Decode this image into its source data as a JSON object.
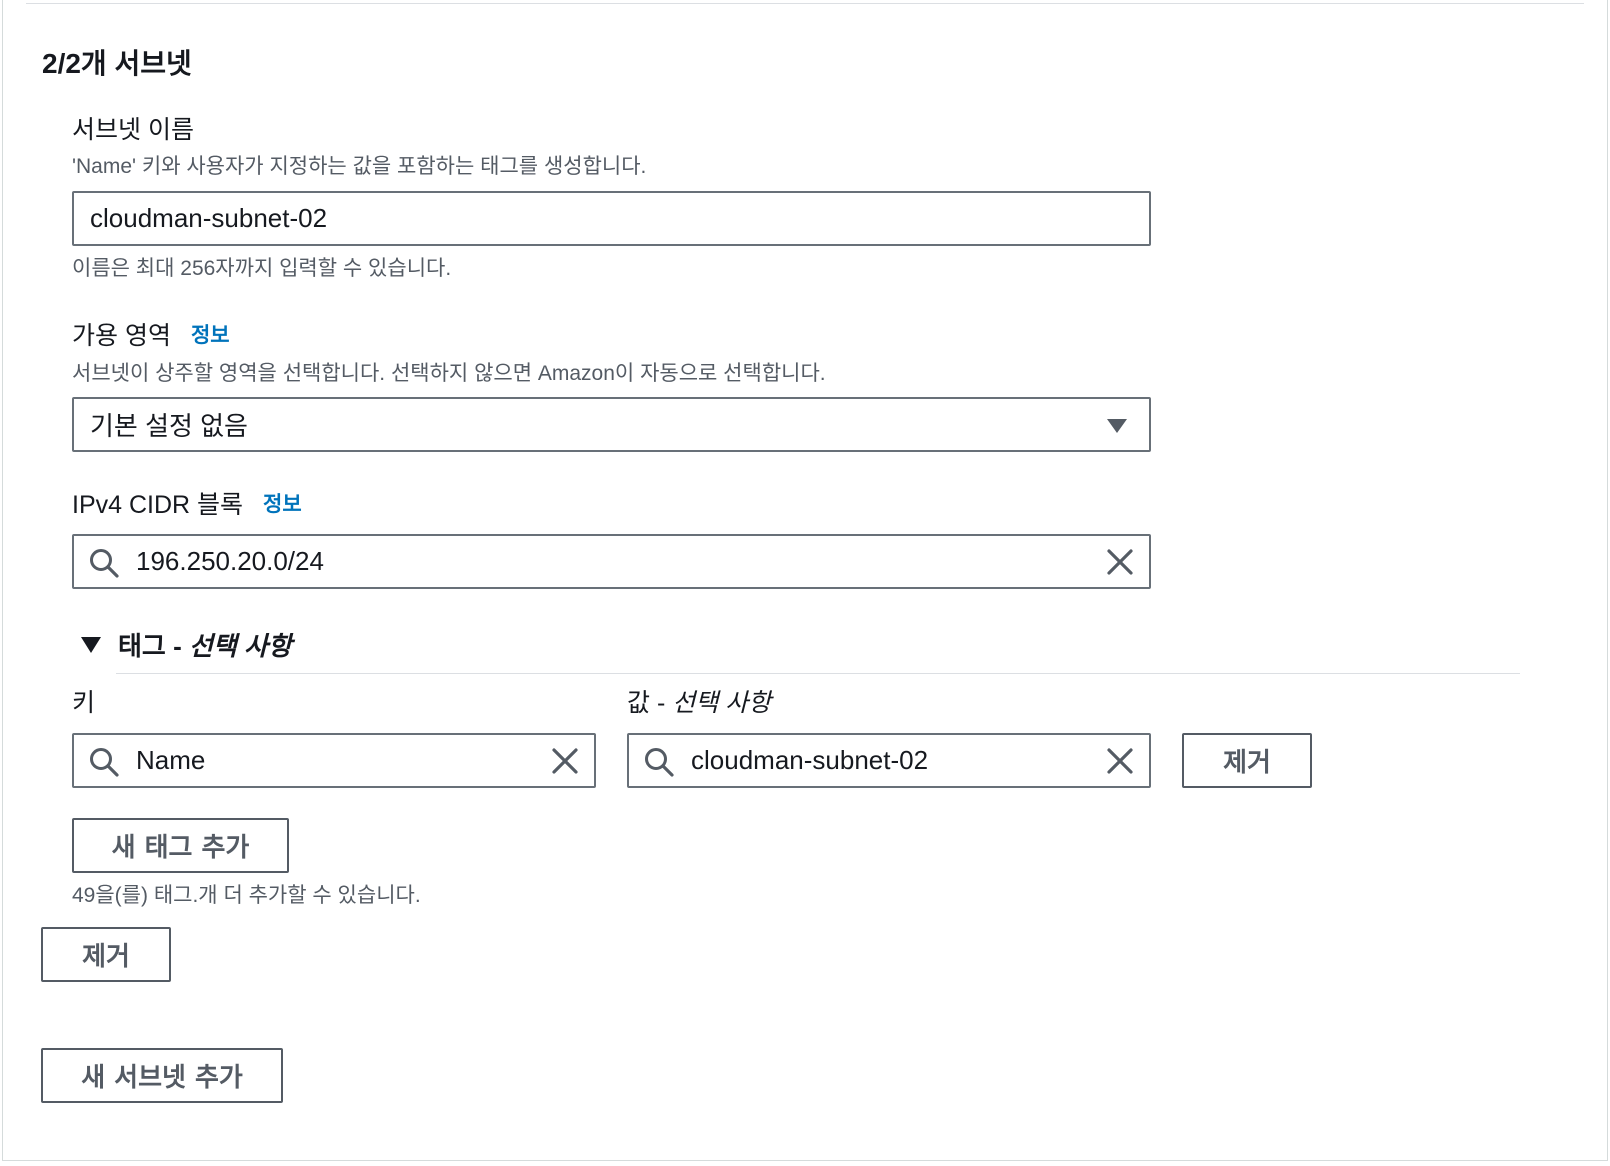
{
  "section": {
    "title": "2/2개 서브넷"
  },
  "subnet_name": {
    "label": "서브넷 이름",
    "description": "'Name' 키와 사용자가 지정하는 값을 포함하는 태그를 생성합니다.",
    "value": "cloudman-subnet-02",
    "hint": "이름은 최대 256자까지 입력할 수 있습니다."
  },
  "availability_zone": {
    "label": "가용 영역",
    "info": "정보",
    "description": "서브넷이 상주할 영역을 선택합니다. 선택하지 않으면 Amazon이 자동으로 선택합니다.",
    "selected": "기본 설정 없음"
  },
  "cidr": {
    "label": "IPv4 CIDR 블록",
    "info": "정보",
    "value": "196.250.20.0/24"
  },
  "tags": {
    "header_prefix": "태그 - ",
    "header_optional": "선택 사항",
    "key_label": "키",
    "value_label_prefix": "값 - ",
    "value_label_optional": "선택 사항",
    "rows": [
      {
        "key": "Name",
        "value": "cloudman-subnet-02",
        "remove_label": "제거"
      }
    ],
    "add_label": "새 태그 추가",
    "remaining_text": "49을(를) 태그.개 더 추가할 수 있습니다."
  },
  "remove_subnet_label": "제거",
  "add_subnet_label": "새 서브넷 추가",
  "colors": {
    "info_link": "#0073bb",
    "border": "#687078",
    "text": "#16191f",
    "muted": "#545b64"
  }
}
